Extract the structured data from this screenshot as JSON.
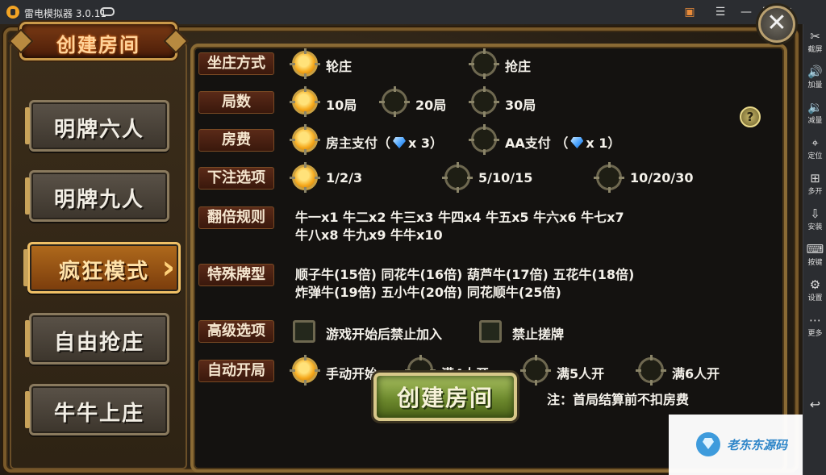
{
  "window": {
    "app_title": "雷电模拟器 3.0.11",
    "controls": {
      "menu": "☰",
      "minimize": "—",
      "maximize": "☐",
      "close": "✕"
    }
  },
  "sidebar": {
    "items": [
      {
        "icon": "scissors-icon",
        "glyph": "✂",
        "label": "截屏"
      },
      {
        "icon": "volume-up-icon",
        "glyph": "🔊",
        "label": "加量"
      },
      {
        "icon": "volume-down-icon",
        "glyph": "🔉",
        "label": "减量"
      },
      {
        "icon": "location-icon",
        "glyph": "⌖",
        "label": "定位"
      },
      {
        "icon": "multi-open-icon",
        "glyph": "⊞",
        "label": "多开"
      },
      {
        "icon": "install-icon",
        "glyph": "⇩",
        "label": "安装"
      },
      {
        "icon": "keyboard-icon",
        "glyph": "⌨",
        "label": "按键"
      },
      {
        "icon": "settings-icon",
        "glyph": "⚙",
        "label": "设置"
      },
      {
        "icon": "more-icon",
        "glyph": "⋯",
        "label": "更多"
      }
    ],
    "back_glyph": "↩"
  },
  "game": {
    "header_title": "创建房间",
    "close_glyph": "✕",
    "help_glyph": "?",
    "modes": [
      {
        "label": "明牌六人",
        "active": false
      },
      {
        "label": "明牌九人",
        "active": false
      },
      {
        "label": "疯狂模式",
        "active": true
      },
      {
        "label": "自由抢庄",
        "active": false
      },
      {
        "label": "牛牛上庄",
        "active": false
      }
    ],
    "options": {
      "banker": {
        "label": "坐庄方式",
        "choices": [
          "轮庄",
          "抢庄"
        ],
        "selected": 0
      },
      "rounds": {
        "label": "局数",
        "choices": [
          "10局",
          "20局",
          "30局"
        ],
        "selected": 0
      },
      "fee": {
        "label": "房费",
        "choices": [
          {
            "text": "房主支付（",
            "qty": "x 3）"
          },
          {
            "text": "AA支付 （",
            "qty": "x 1）"
          }
        ],
        "selected": 0
      },
      "bet": {
        "label": "下注选项",
        "choices": [
          "1/2/3",
          "5/10/15",
          "10/20/30"
        ],
        "selected": 0
      },
      "double_rules": {
        "label": "翻倍规则",
        "line1": "牛一x1  牛二x2  牛三x3  牛四x4  牛五x5  牛六x6  牛七x7",
        "line2": "牛八x8  牛九x9  牛牛x10"
      },
      "special": {
        "label": "特殊牌型",
        "line1": "顺子牛(15倍)  同花牛(16倍)  葫芦牛(17倍)  五花牛(18倍)",
        "line2": "炸弹牛(19倍)  五小牛(20倍)  同花顺牛(25倍)"
      },
      "advanced": {
        "label": "高级选项",
        "choices": [
          "游戏开始后禁止加入",
          "禁止搓牌"
        ]
      },
      "auto_start": {
        "label": "自动开局",
        "choices": [
          "手动开始",
          "满4人开",
          "满5人开",
          "满6人开"
        ],
        "selected": 0
      }
    },
    "create_button": "创建房间",
    "note": "注：首局结算前不扣房费"
  },
  "watermark": {
    "text": "老东东源码"
  },
  "colors": {
    "accent_gold": "#c9994a",
    "selected_orange": "#f5a81c",
    "create_green": "#6e8a2e"
  }
}
